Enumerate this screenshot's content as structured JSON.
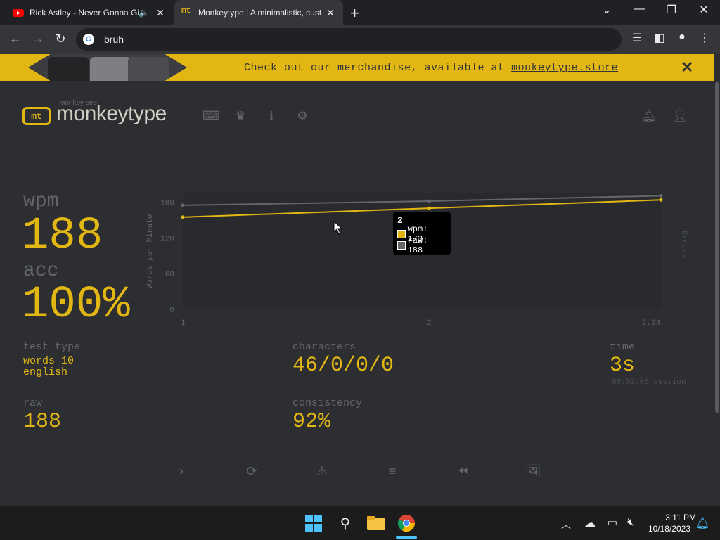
{
  "browser": {
    "tabs": [
      {
        "title": "Rick Astley - Never Gonna Gi",
        "active": false
      },
      {
        "title": "Monkeytype | A minimalistic, cust",
        "active": true
      }
    ],
    "address": "bruh"
  },
  "banner": {
    "text_prefix": "Check out our merchandise, available at ",
    "link": "monkeytype.store"
  },
  "header": {
    "logo_mark": "mt",
    "logo_sub": "monkey see",
    "logo_text": "monkeytype"
  },
  "results": {
    "wpm_label": "wpm",
    "wpm": "188",
    "acc_label": "acc",
    "acc": "100%",
    "test_type_label": "test type",
    "test_type_line1": "words 10",
    "test_type_line2": "english",
    "raw_label": "raw",
    "raw": "188",
    "characters_label": "characters",
    "characters": "46/0/0/0",
    "consistency_label": "consistency",
    "consistency": "92%",
    "time_label": "time",
    "time": "3s",
    "session": "00:02:06 session"
  },
  "chart_data": {
    "type": "line",
    "x": [
      1,
      2,
      2.94
    ],
    "x_tick_labels": [
      "1",
      "2",
      "2.94"
    ],
    "series": [
      {
        "name": "wpm",
        "values": [
          155,
          170,
          184
        ],
        "color": "#e2b714"
      },
      {
        "name": "raw",
        "values": [
          175,
          182,
          191
        ],
        "color": "#646669"
      }
    ],
    "ylabel": "Words per Minute",
    "y2label": "Errors",
    "ylim": [
      0,
      195
    ],
    "y_ticks": [
      0,
      60,
      120,
      180
    ],
    "tooltip": {
      "title": "2",
      "wpm": "wpm: 173",
      "raw": "raw: 188"
    }
  },
  "taskbar": {
    "time": "3:11 PM",
    "date": "10/18/2023"
  }
}
